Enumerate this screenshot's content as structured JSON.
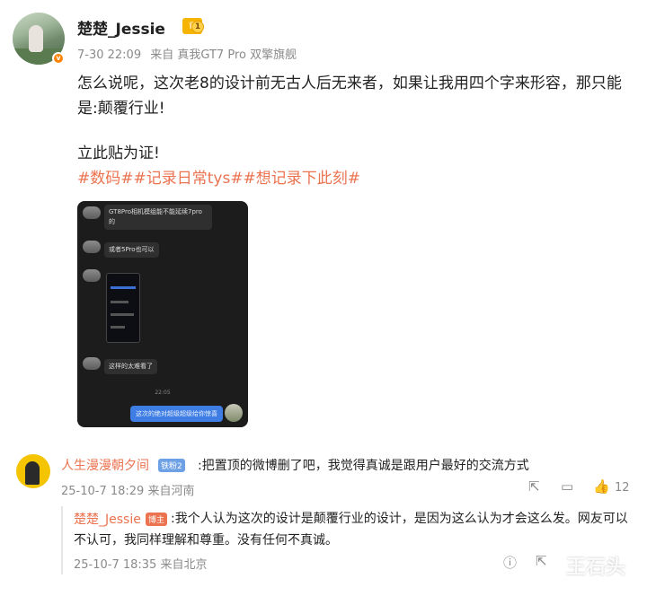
{
  "post": {
    "username": "楚楚_Jessie",
    "level": "1",
    "date": "7-30 22:09",
    "source": "来自 真我GT7 Pro 双擎旗舰",
    "lines": [
      "怎么说呢，这次老8的设计前无古人后无来者，如果让我用四个字来形容，那只能",
      "是:颠覆行业!",
      "",
      "立此贴为证!"
    ],
    "hashtags": "#数码##记录日常tys##想记录下此刻#"
  },
  "chat": {
    "msg1": "GT8Pro相机模组能不能延续7pro的",
    "msg2": "或者5Pro也可以",
    "msg3": "这样的太难看了",
    "time": "22:05",
    "my_msg": "这次的绝对超级超级给你惊喜"
  },
  "comment": {
    "name": "人生漫漫朝夕间",
    "tag": "铁粉2",
    "text": ":把置顶的微博删了吧，我觉得真诚是跟用户最好的交流方式",
    "date": "25-10-7 18:29 来自河南",
    "likes": "12"
  },
  "reply": {
    "name": "楚楚_Jessie",
    "tag": "博主",
    "text": ":我个人认为这次的设计是颠覆行业的设计，是因为这么认为才会这么发。网友可以不认可，我同样理解和尊重。没有任何不真诚。",
    "date": "25-10-7 18:35 来自北京"
  },
  "watermark": "王石头",
  "colors": {
    "accent": "#eb7350",
    "meta": "#8a8a8a",
    "chat_bg": "#1c1c1c",
    "my_bubble": "#3e7de3"
  }
}
